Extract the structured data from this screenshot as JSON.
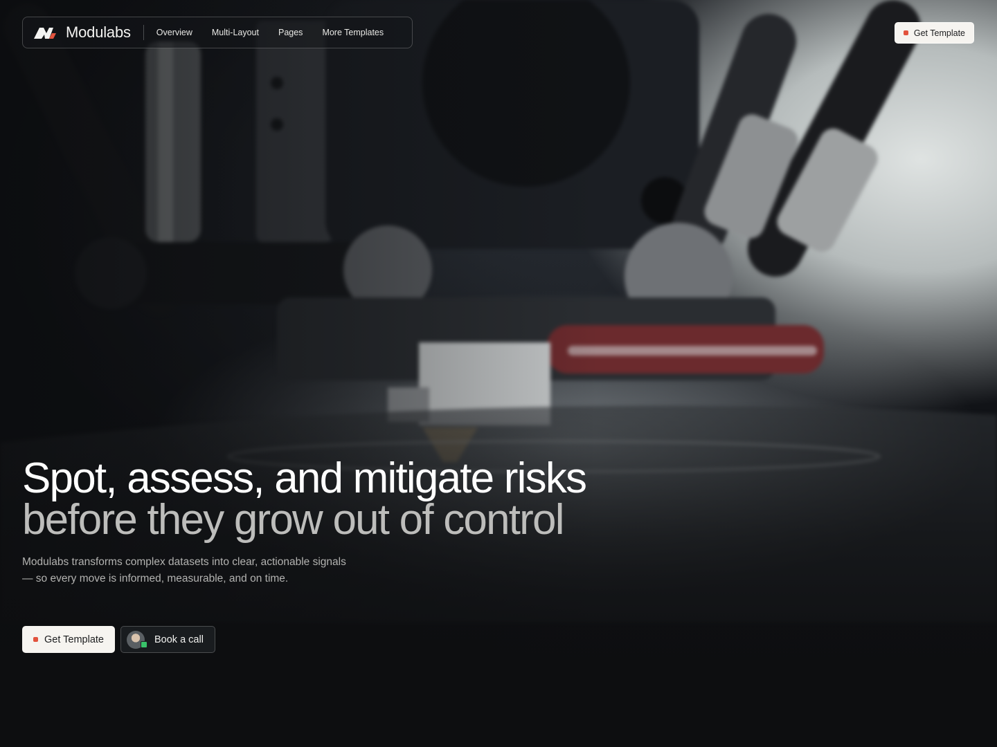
{
  "brand": {
    "name": "Modulabs",
    "logo_icon": "modulabs-logo-icon",
    "accent_color": "#e2533e"
  },
  "nav": {
    "links": [
      {
        "label": "Overview"
      },
      {
        "label": "Multi-Layout"
      },
      {
        "label": "Pages"
      },
      {
        "label": "More Templates"
      }
    ],
    "cta_label": "Get Template"
  },
  "hero": {
    "headline_line1": "Spot, assess, and mitigate risks",
    "headline_line2": "before they grow out of control",
    "subcopy": "Modulabs transforms complex datasets into clear, actionable signals — so every move is informed, measurable, and on time.",
    "primary_cta": "Get Template",
    "secondary_cta": "Book a call",
    "status_color": "#39c26a"
  }
}
